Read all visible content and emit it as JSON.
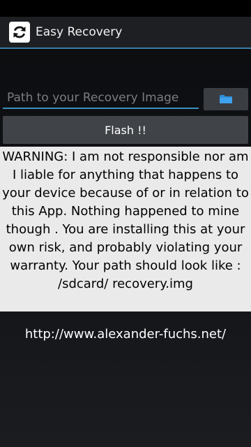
{
  "app": {
    "title": "Easy Recovery",
    "icon": "refresh-icon"
  },
  "form": {
    "path_placeholder": "Path to your Recovery Image",
    "browse_icon": "folder-icon",
    "flash_label": "Flash !!"
  },
  "warning_text": "WARNING: I am not responsible nor am I liable for anything that happens to your device because of or in relation to this App. Nothing happened to mine though . You are installing this at your own risk, and probably violating your warranty. Your path should look like : /sdcard/ recovery.img",
  "footer_url": "http://www.alexander-fuchs.net/",
  "colors": {
    "accent": "#3b8fbf",
    "folder": "#2f8fd8"
  }
}
